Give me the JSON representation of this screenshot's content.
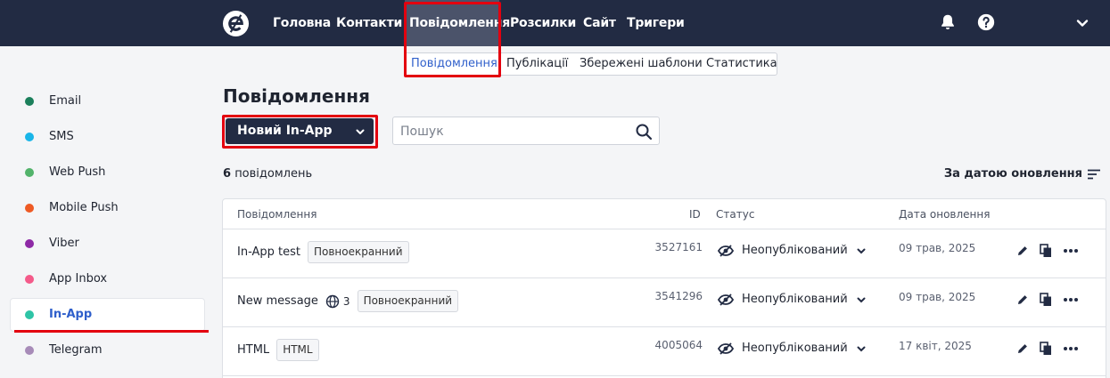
{
  "nav": {
    "items": [
      {
        "label": "Головна"
      },
      {
        "label": "Контакти"
      },
      {
        "label": "Повідомлення"
      },
      {
        "label": "Розсилки"
      },
      {
        "label": "Сайт"
      },
      {
        "label": "Тригери"
      }
    ],
    "active": "Повідомлення",
    "icons": [
      "bell-icon",
      "help-icon",
      "chevron-down-icon"
    ]
  },
  "subtabs": [
    {
      "label": "Повідомлення"
    },
    {
      "label": "Публікації"
    },
    {
      "label": "Збережені шаблони"
    },
    {
      "label": "Статистика"
    }
  ],
  "sidebar": {
    "items": [
      {
        "label": "Email",
        "color": "#1b7f5b"
      },
      {
        "label": "SMS",
        "color": "#19b5e8"
      },
      {
        "label": "Web Push",
        "color": "#52b36b"
      },
      {
        "label": "Mobile Push",
        "color": "#ee5a24"
      },
      {
        "label": "Viber",
        "color": "#8e2aa6"
      },
      {
        "label": "App Inbox",
        "color": "#f45a8a"
      },
      {
        "label": "In-App",
        "color": "#2ec4a6"
      },
      {
        "label": "Telegram",
        "color": "#a78bb8"
      }
    ],
    "active": "In-App"
  },
  "main": {
    "title": "Повідомлення",
    "new_button": "Новий In-App",
    "search_placeholder": "Пошук",
    "count_value": "6",
    "count_label": "повідомлень",
    "sort_label": "За датою оновлення"
  },
  "table": {
    "columns": [
      "Повідомлення",
      "ID",
      "Статус",
      "Дата оновлення"
    ],
    "rows": [
      {
        "name": "In-App test",
        "lang_count": "",
        "tag": "Повноекранний",
        "id": "3527161",
        "status": "Неопублікований",
        "date": "09 трав, 2025"
      },
      {
        "name": "New message",
        "lang_count": "3",
        "tag": "Повноекранний",
        "id": "3541296",
        "status": "Неопублікований",
        "date": "09 трав, 2025"
      },
      {
        "name": "HTML",
        "lang_count": "",
        "tag": "HTML",
        "id": "4005064",
        "status": "Неопублікований",
        "date": "17 квіт, 2025"
      }
    ]
  },
  "colors": {
    "nav_bg": "#222b43",
    "accent": "#2f5fcb",
    "highlight": "#e3000f"
  }
}
